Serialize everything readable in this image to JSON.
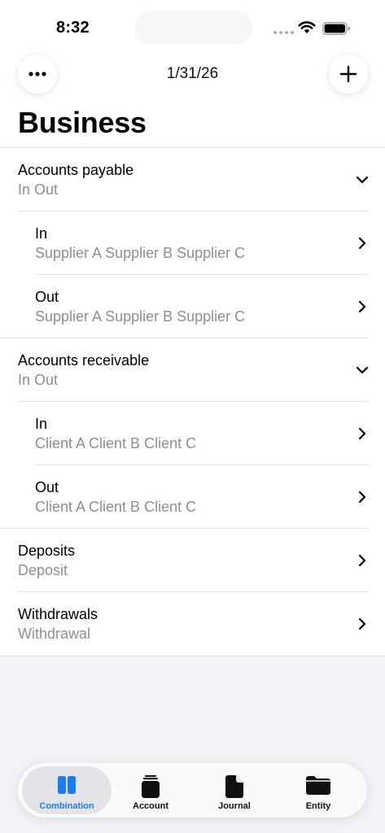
{
  "status_bar": {
    "time": "8:32"
  },
  "header": {
    "date": "1/31/26",
    "title": "Business"
  },
  "list": [
    {
      "title": "Accounts payable",
      "subtitle": "In Out",
      "level": 0,
      "chevron": "chevron-down-icon"
    },
    {
      "title": "In",
      "subtitle": "Supplier A Supplier B Supplier C",
      "level": 1,
      "chevron": "chevron-right-icon"
    },
    {
      "title": "Out",
      "subtitle": "Supplier A Supplier B Supplier C",
      "level": 1,
      "chevron": "chevron-right-icon"
    },
    {
      "title": "Accounts receivable",
      "subtitle": "In Out",
      "level": 0,
      "chevron": "chevron-down-icon"
    },
    {
      "title": "In",
      "subtitle": "Client A Client B Client C",
      "level": 1,
      "chevron": "chevron-right-icon"
    },
    {
      "title": "Out",
      "subtitle": "Client A Client B Client C",
      "level": 1,
      "chevron": "chevron-right-icon"
    },
    {
      "title": "Deposits",
      "subtitle": "Deposit",
      "level": 0,
      "chevron": "chevron-right-icon"
    },
    {
      "title": "Withdrawals",
      "subtitle": "Withdrawal",
      "level": 0,
      "chevron": "chevron-right-icon"
    }
  ],
  "tab_bar": {
    "tabs": [
      {
        "label": "Combination",
        "icon": "columns-icon",
        "active": true
      },
      {
        "label": "Account",
        "icon": "stack-icon",
        "active": false
      },
      {
        "label": "Journal",
        "icon": "document-icon",
        "active": false
      },
      {
        "label": "Entity",
        "icon": "folder-icon",
        "active": false
      }
    ]
  },
  "colors": {
    "accent": "#1a7cf5",
    "secondary_text": "#8e8e93",
    "background": "#f2f2f7"
  }
}
